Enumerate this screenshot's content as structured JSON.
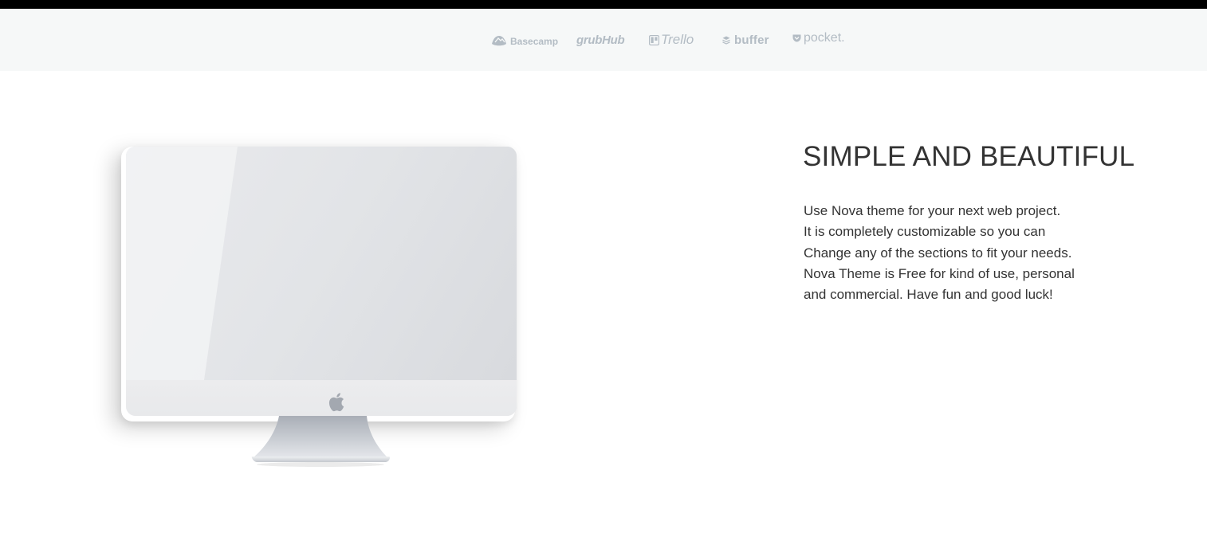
{
  "partners": [
    {
      "name": "Basecamp",
      "icon": "basecamp-icon"
    },
    {
      "name": "grubHub",
      "icon": ""
    },
    {
      "name": "Trello",
      "icon": "trello-icon"
    },
    {
      "name": "buffer",
      "icon": "buffer-icon"
    },
    {
      "name": "pocket.",
      "icon": "pocket-icon"
    }
  ],
  "feature": {
    "title": "SIMPLE AND BEAUTIFUL",
    "lines": [
      "Use Nova theme for your next web project.",
      "It is completely customizable so you can",
      "Change any of the sections to fit your needs.",
      "Nova Theme is Free for kind of use, personal",
      "and commercial. Have fun and good luck!"
    ]
  },
  "colors": {
    "top_bar": "#000000",
    "logos_background": "#f6f8f8",
    "logo_gray": "#b3bcc4",
    "text": "#333333"
  }
}
